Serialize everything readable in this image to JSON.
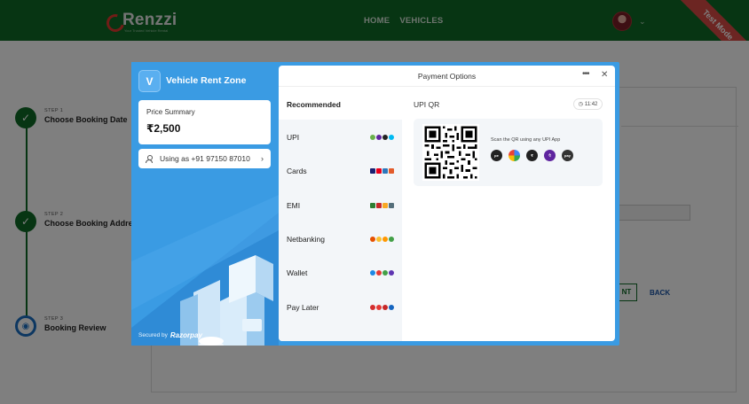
{
  "topbar": {
    "brand": "Renzzi",
    "tagline": "Your Trusted Vehicle Rental",
    "nav": [
      "HOME",
      "VEHICLES"
    ],
    "ribbon": "Test Mode",
    "colors": {
      "bar": "#0e6b27",
      "ribbon": "#d94b44"
    }
  },
  "stepper": {
    "steps": [
      {
        "num": "STEP 1",
        "title": "Choose Booking Date",
        "status": "done"
      },
      {
        "num": "STEP 2",
        "title": "Choose Booking Address",
        "status": "done"
      },
      {
        "num": "STEP 3",
        "title": "Booking Review",
        "status": "current"
      }
    ]
  },
  "background": {
    "primary_button": "NT",
    "back_button": "BACK"
  },
  "checkout": {
    "merchant_initial": "V",
    "merchant_name": "Vehicle Rent Zone",
    "price_label": "Price Summary",
    "price_value": "₹2,500",
    "user_contact": "Using as +91 97150 87010",
    "secured_by": "Secured by",
    "secured_brand": "Razorpay",
    "title": "Payment Options",
    "recommended": "Recommended",
    "methods": [
      "UPI",
      "Cards",
      "EMI",
      "Netbanking",
      "Wallet",
      "Pay Later"
    ],
    "qr_label": "UPI QR",
    "timer": "11:42",
    "scan_text": "Scan the QR using any UPI App",
    "upi_apps": [
      "phonepe-icon",
      "google-pay-icon",
      "paytm-icon",
      "phonepe-purple-icon",
      "bhim-icon"
    ],
    "accent": "#3a9be3"
  }
}
